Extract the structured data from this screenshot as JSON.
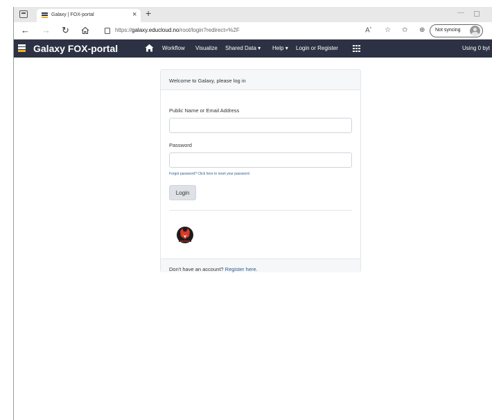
{
  "browser": {
    "tab_title": "Galaxy | FOX-portal",
    "close_glyph": "×",
    "new_tab_glyph": "+",
    "url_prefix": "https://",
    "url_host": "galaxy.educloud.no",
    "url_path": "/root/login?redirect=%2F",
    "sync_label": "Not syncing",
    "nav_icons": [
      "back-arrow-icon",
      "forward-arrow-icon",
      "refresh-icon",
      "home-icon",
      "lock-icon"
    ],
    "tool_icons": [
      "read-aloud-icon",
      "add-favorite-icon",
      "favorites-icon",
      "collections-icon",
      "profile-icon"
    ]
  },
  "masthead": {
    "brand": "Galaxy FOX-portal",
    "menu": {
      "workflow": "Workflow",
      "visualize": "Visualize",
      "shared_data": "Shared Data",
      "help": "Help",
      "login_register": "Login or Register"
    },
    "usage": "Using 0 byt",
    "bg_color": "#2c3143",
    "brand_yellow": "#f0b323"
  },
  "login": {
    "header": "Welcome to Galaxy, please log in",
    "email_label": "Public Name or Email Address",
    "email_value": "",
    "password_label": "Password",
    "password_value": "",
    "forgot_text": "Forgot password? Click here to reset your password.",
    "login_button": "Login",
    "footer_prefix": "Don't have an account? ",
    "footer_link": "Register here.",
    "link_color": "#2c5d8a"
  }
}
